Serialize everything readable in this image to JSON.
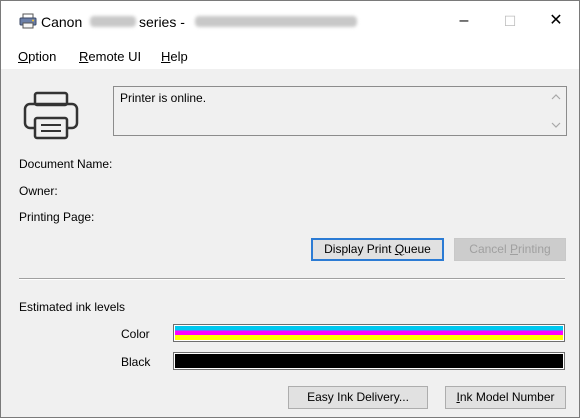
{
  "window": {
    "title_brand": "Canon",
    "title_series": "series -",
    "minimize_glyph": "–",
    "maximize_glyph": "☐",
    "close_glyph": "✕"
  },
  "menu": {
    "items": [
      {
        "accel": "O",
        "rest": "ption"
      },
      {
        "accel": "R",
        "rest": "emote UI"
      },
      {
        "accel": "H",
        "rest": "elp"
      }
    ]
  },
  "status": {
    "message": "Printer is online."
  },
  "job_info": {
    "document_name_label": "Document Name:",
    "owner_label": "Owner:",
    "printing_page_label": "Printing Page:"
  },
  "buttons": {
    "display_queue_pre": "Display Print ",
    "display_queue_accel": "Q",
    "display_queue_post": "ueue",
    "cancel_pre": "Cancel ",
    "cancel_accel": "P",
    "cancel_post": "rinting",
    "easy_ink": "Easy Ink Delivery...",
    "ink_model_accel": "I",
    "ink_model_rest": "nk Model Number"
  },
  "ink": {
    "section_label": "Estimated ink levels",
    "color_label": "Color",
    "black_label": "Black",
    "color_level": 1.0,
    "black_level": 1.0,
    "color_bands": [
      "#00c8f0",
      "#ff00ff",
      "#ffff00"
    ],
    "black_color": "#000000"
  },
  "icons": {
    "app": "printer-app-icon",
    "printer": "printer-icon",
    "scroll_up": "chevron-up-icon",
    "scroll_down": "chevron-down-icon"
  }
}
